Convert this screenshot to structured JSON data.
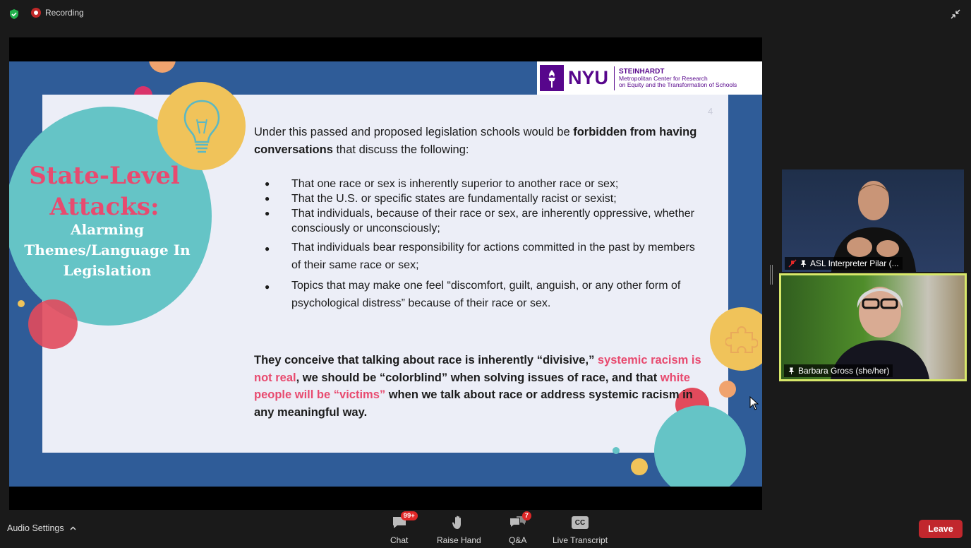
{
  "topbar": {
    "recording_label": "Recording"
  },
  "logo": {
    "nyu": "NYU",
    "steinhardt": "STEINHARDT",
    "center_line1": "Metropolitan Center for Research",
    "center_line2": "on Equity and the Transformation of Schools"
  },
  "slide": {
    "title": "State-Level Attacks:",
    "subtitle": "Alarming Themes/Language In Legislation",
    "page_number": "4",
    "intro_plain": "Under this passed and proposed legislation schools would be ",
    "intro_bold1": "forbidden from having conversations",
    "intro_end": " that discuss the following:",
    "bullets": [
      "That one race or sex is inherently superior to another race or sex;",
      "That the U.S. or specific states are fundamentally racist or sexist;",
      "That individuals, because of their race or sex, are inherently oppressive, whether consciously or unconsciously;",
      "That individuals bear responsibility for actions committed in the past by members of their same race or sex;",
      "Topics that may make one feel “discomfort, guilt, anguish, or any other form of psychological distress” because of their race or sex."
    ],
    "closing_1": "They conceive that talking about race is inherently “divisive,” ",
    "closing_pink1": "systemic racism is not real",
    "closing_2": ", we should be “colorblind” when solving issues of race, and that ",
    "closing_pink2": "white people will be “victims”",
    "closing_3": " when we talk about race or address systemic racism in any meaningful way."
  },
  "participants": [
    {
      "name": "ASL Interpreter Pilar (..."
    },
    {
      "name": "Barbara Gross (she/her)"
    }
  ],
  "toolbar": {
    "audio_settings": "Audio Settings",
    "chat_label": "Chat",
    "chat_badge": "99+",
    "raise_hand_label": "Raise Hand",
    "qa_label": "Q&A",
    "qa_badge": "7",
    "live_transcript_label": "Live Transcript",
    "cc_text": "CC",
    "leave_label": "Leave"
  },
  "colors": {
    "slide_bg": "#2f5c98",
    "accent_pink": "#e84a6f",
    "teal": "#65c4c6",
    "leave_red": "#c1272d",
    "active_speaker_border": "#d8e86a"
  }
}
